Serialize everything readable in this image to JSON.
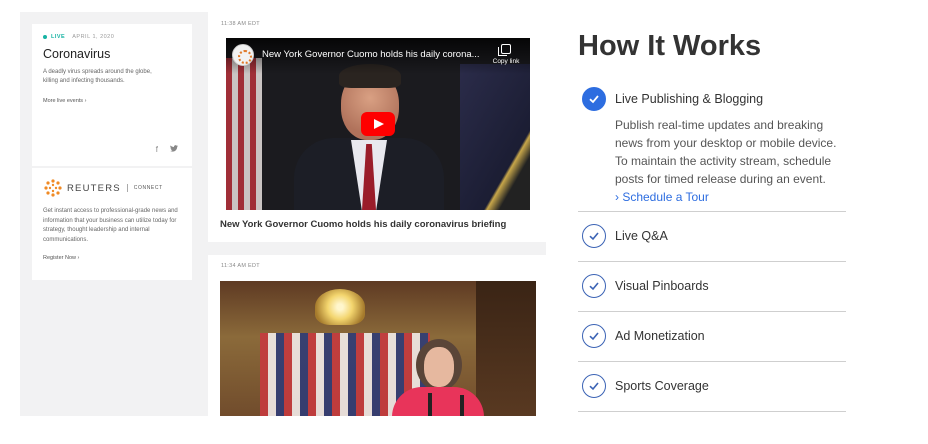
{
  "preview": {
    "live_card": {
      "live_tag": "LIVE",
      "date": "APRIL 1, 2020",
      "title": "Coronavirus",
      "description": "A deadly virus spreads around the globe, killing and infecting thousands.",
      "more_link": "More live events ›",
      "social_icons": [
        "facebook-icon",
        "twitter-icon"
      ]
    },
    "reuters_card": {
      "brand": "REUTERS",
      "brand_suffix": "CONNECT",
      "description": "Get instant access to professional-grade news and information that your business can utilize today for strategy, thought leadership and internal communications.",
      "register_link": "Register Now ›"
    },
    "posts": [
      {
        "time": "11:38 AM EDT",
        "video_title": "New York Governor Cuomo holds his daily corona...",
        "copy_label": "Copy link",
        "headline": "New York Governor Cuomo holds his daily coronavirus briefing"
      },
      {
        "time": "11:34 AM EDT"
      }
    ]
  },
  "how_it_works": {
    "title": "How It Works",
    "items": [
      {
        "label": "Live Publishing & Blogging",
        "active": true,
        "body": "Publish real-time updates and breaking news from your desktop or mobile device. To maintain the activity stream, schedule posts for timed release during an event.",
        "link": "› Schedule a Tour"
      },
      {
        "label": "Live Q&A",
        "active": false
      },
      {
        "label": "Visual Pinboards",
        "active": false
      },
      {
        "label": "Ad Monetization",
        "active": false
      },
      {
        "label": "Sports Coverage",
        "active": false
      }
    ]
  },
  "colors": {
    "accent": "#2d6de0",
    "live": "#16b3a3",
    "play": "#ff0000"
  }
}
